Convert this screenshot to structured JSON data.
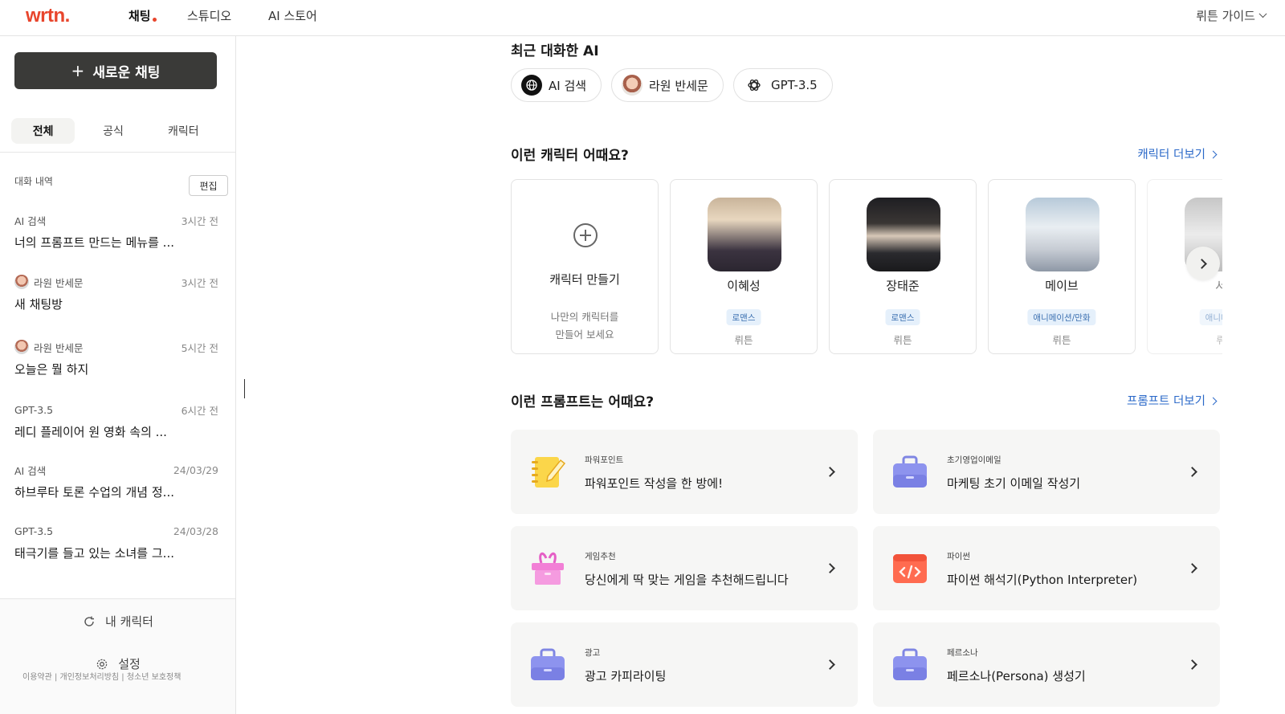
{
  "nav": {
    "logo": "wrtn.",
    "links": [
      "채팅",
      "스튜디오",
      "AI 스토어"
    ],
    "guide": "뤼튼 가이드"
  },
  "sidebar": {
    "new_chat": "새로운 채팅",
    "tabs": [
      "전체",
      "공식",
      "캐릭터"
    ],
    "history_label": "대화 내역",
    "edit_label": "편집",
    "conversations": [
      {
        "source": "AI 검색",
        "time": "3시간 전",
        "title": "너의 프롬프트 만드는 메뉴를 ..."
      },
      {
        "source": "라원 반세문",
        "time": "3시간 전",
        "title": "새 채팅방"
      },
      {
        "source": "라원 반세문",
        "time": "5시간 전",
        "title": "오늘은 뭘 하지"
      },
      {
        "source": "GPT-3.5",
        "time": "6시간 전",
        "title": "레디 플레이어 원 영화 속의 ..."
      },
      {
        "source": "AI 검색",
        "time": "24/03/29",
        "title": "하브루타 토론 수업의 개념 정..."
      },
      {
        "source": "GPT-3.5",
        "time": "24/03/28",
        "title": "태극기를 들고 있는 소녀를 그..."
      }
    ],
    "my_character": "내 캐릭터",
    "settings": "설정",
    "footer": "이용약관 | 개인정보처리방침 | 청소년 보호정책"
  },
  "recent": {
    "title": "최근 대화한 AI",
    "items": [
      "AI 검색",
      "라원 반세문",
      "GPT-3.5"
    ]
  },
  "characters": {
    "title": "이런 캐릭터 어때요?",
    "more": "캐릭터 더보기",
    "create_title": "캐릭터 만들기",
    "create_desc_1": "나만의 캐릭터를",
    "create_desc_2": "만들어 보세요",
    "items": [
      {
        "name": "이혜성",
        "tag": "로맨스",
        "author": "뤼튼"
      },
      {
        "name": "장태준",
        "tag": "로맨스",
        "author": "뤼튼"
      },
      {
        "name": "메이브",
        "tag": "애니메이션/만화",
        "author": "뤼튼"
      },
      {
        "name": "서",
        "tag": "애니메이",
        "author": "뤼"
      }
    ]
  },
  "prompts": {
    "title": "이런 프롬프트는 어때요?",
    "more": "프롬프트 더보기",
    "items": [
      {
        "category": "파워포인트",
        "title": "파워포인트 작성을 한 방에!",
        "icon": "notebook-pencil-icon"
      },
      {
        "category": "초기영업이메일",
        "title": "마케팅 초기 이메일 작성기",
        "icon": "briefcase-icon"
      },
      {
        "category": "게임추천",
        "title": "당신에게 딱 맞는 게임을 추천해드립니다",
        "icon": "gift-box-icon"
      },
      {
        "category": "파이썬",
        "title": "파이썬 해석기(Python Interpreter)",
        "icon": "code-window-icon"
      },
      {
        "category": "광고",
        "title": "광고 카피라이팅",
        "icon": "briefcase-icon"
      },
      {
        "category": "페르소나",
        "title": "페르소나(Persona) 생성기",
        "icon": "briefcase-icon"
      }
    ]
  },
  "colors": {
    "brand": "#e8452c",
    "link": "#2a68c8",
    "new_chat_bg": "#3a3a38"
  }
}
